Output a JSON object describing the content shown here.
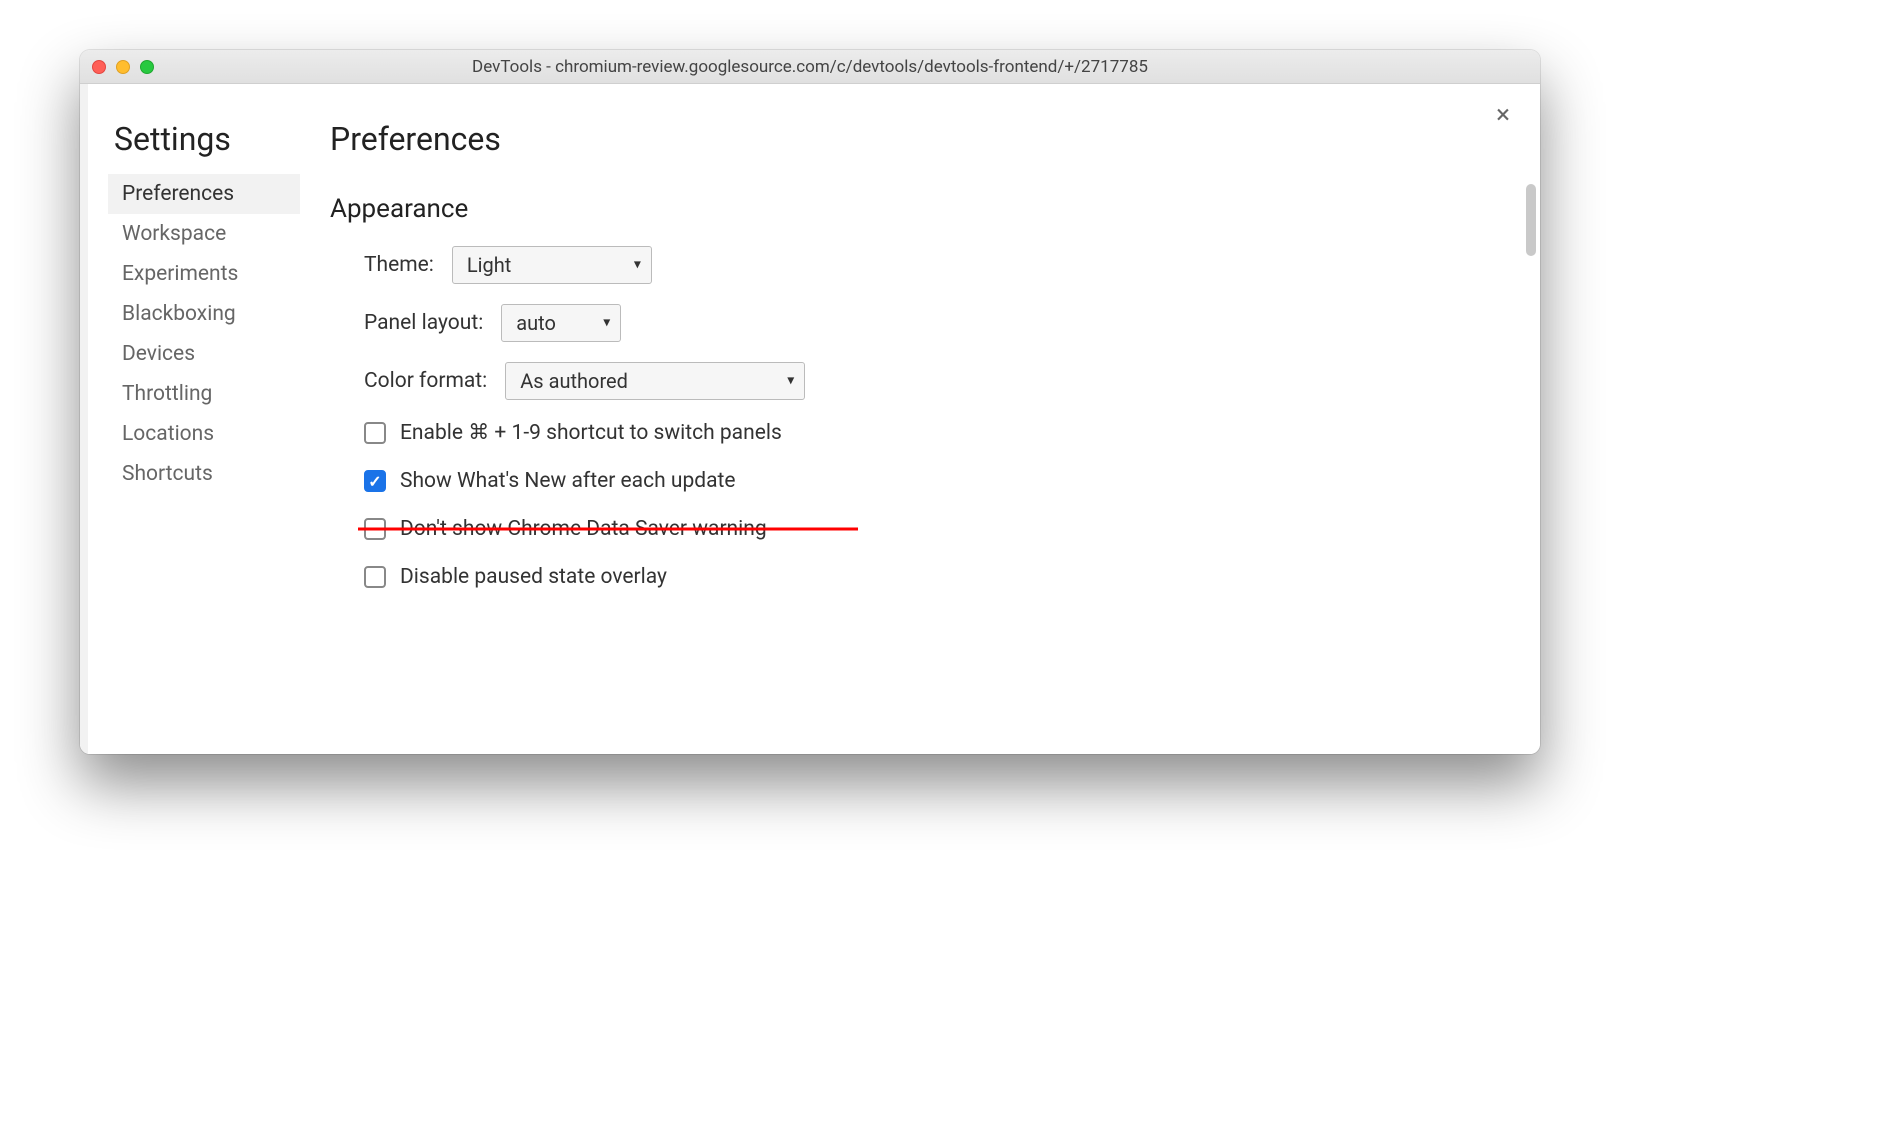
{
  "window": {
    "title": "DevTools - chromium-review.googlesource.com/c/devtools/devtools-frontend/+/2717785"
  },
  "sidebar": {
    "title": "Settings",
    "items": [
      {
        "label": "Preferences",
        "active": true
      },
      {
        "label": "Workspace",
        "active": false
      },
      {
        "label": "Experiments",
        "active": false
      },
      {
        "label": "Blackboxing",
        "active": false
      },
      {
        "label": "Devices",
        "active": false
      },
      {
        "label": "Throttling",
        "active": false
      },
      {
        "label": "Locations",
        "active": false
      },
      {
        "label": "Shortcuts",
        "active": false
      }
    ]
  },
  "main": {
    "title": "Preferences",
    "section": "Appearance",
    "theme": {
      "label": "Theme:",
      "value": "Light"
    },
    "panel_layout": {
      "label": "Panel layout:",
      "value": "auto"
    },
    "color_format": {
      "label": "Color format:",
      "value": "As authored"
    },
    "checkboxes": [
      {
        "label": "Enable ⌘ + 1-9 shortcut to switch panels",
        "checked": false,
        "struck": false
      },
      {
        "label": "Show What's New after each update",
        "checked": true,
        "struck": false
      },
      {
        "label": "Don't show Chrome Data Saver warning",
        "checked": false,
        "struck": true
      },
      {
        "label": "Disable paused state overlay",
        "checked": false,
        "struck": false
      }
    ]
  },
  "close_glyph": "×"
}
